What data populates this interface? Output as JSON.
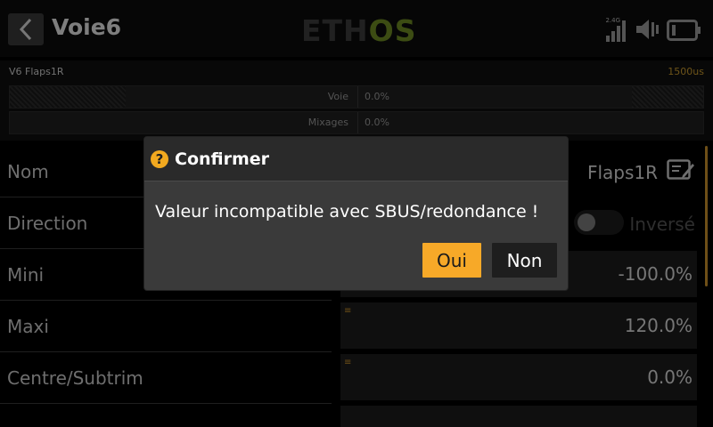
{
  "header": {
    "title": "Voie6",
    "logo_left": "ETH",
    "logo_right": "OS",
    "band": "2.4G"
  },
  "monitor": {
    "channel_label": "V6 Flaps1R",
    "channel_value": "1500us",
    "rows": [
      {
        "label": "Voie",
        "value": "0.0%"
      },
      {
        "label": "Mixages",
        "value": "0.0%"
      }
    ]
  },
  "list": {
    "rows": [
      {
        "label": "Nom",
        "value": "Flaps1R"
      },
      {
        "label": "Direction",
        "value": "Inversé"
      },
      {
        "label": "Mini",
        "value": "-100.0%"
      },
      {
        "label": "Maxi",
        "value": "120.0%"
      },
      {
        "label": "Centre/Subtrim",
        "value": "0.0%"
      }
    ],
    "menu_mark": "≡"
  },
  "dialog": {
    "icon": "?",
    "title": "Confirmer",
    "message": "Valeur incompatible avec SBUS/redondance !",
    "yes_label": "Oui",
    "no_label": "Non"
  },
  "colors": {
    "accent": "#f7a928",
    "logo_green": "#6e8a24",
    "channel_value": "#c89a2e"
  },
  "icons": [
    "back-arrow-icon",
    "signal-bars-icon",
    "speaker-icon",
    "battery-icon",
    "edit-icon",
    "question-icon"
  ]
}
